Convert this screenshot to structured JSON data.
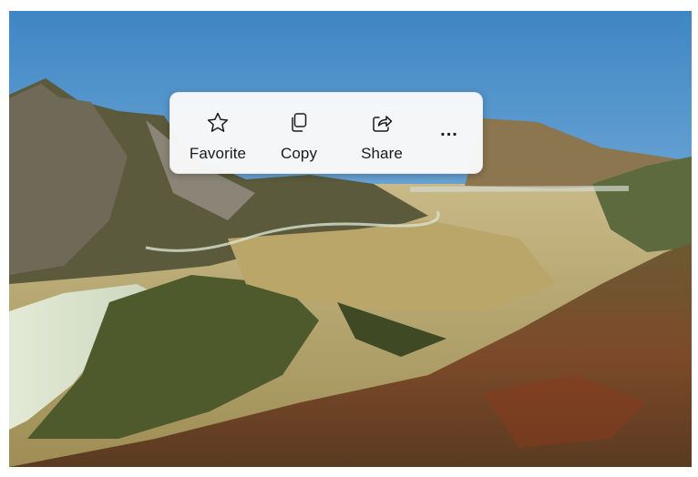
{
  "toolbar": {
    "favorite_label": "Favorite",
    "copy_label": "Copy",
    "share_label": "Share",
    "more_label": "..."
  },
  "icons": {
    "favorite": "star-outline-icon",
    "copy": "copy-icon",
    "share": "share-icon"
  },
  "colors": {
    "toolbar_bg": "#f9f9f9",
    "text": "#1b1b1b"
  }
}
